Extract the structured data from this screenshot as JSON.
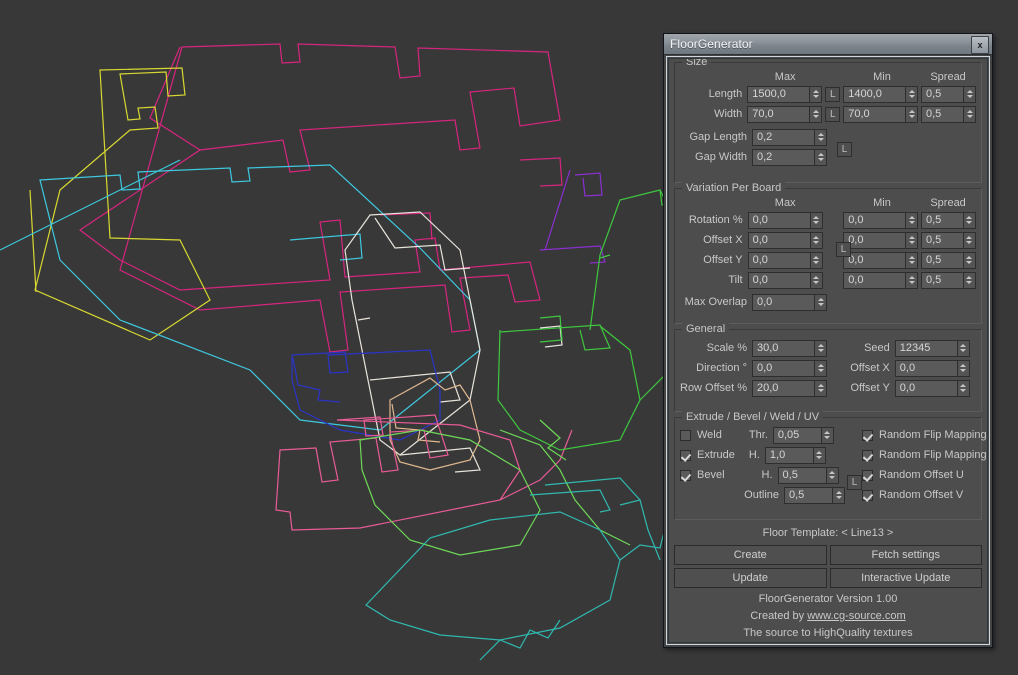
{
  "window": {
    "title": "FloorGenerator",
    "close_label": "x"
  },
  "groups": {
    "size": {
      "title": "Size",
      "columns": {
        "max": "Max",
        "min": "Min",
        "spread": "Spread"
      },
      "rows": [
        {
          "label": "Length",
          "max": "1500,0",
          "link": "L",
          "min": "1400,0",
          "spread": "0,5"
        },
        {
          "label": "Width",
          "max": "70,0",
          "link": "L",
          "min": "70,0",
          "spread": "0,5"
        },
        {
          "label": "Gap Length",
          "max": "0,2"
        },
        {
          "label": "Gap Width",
          "max": "0,2"
        }
      ],
      "gap_link": "L"
    },
    "variation": {
      "title": "Variation Per Board",
      "columns": {
        "max": "Max",
        "min": "Min",
        "spread": "Spread"
      },
      "rows": [
        {
          "label": "Rotation %",
          "max": "0,0",
          "min": "0,0",
          "spread": "0,5"
        },
        {
          "label": "Offset X",
          "max": "0,0",
          "min": "0,0",
          "spread": "0,5"
        },
        {
          "label": "Offset Y",
          "max": "0,0",
          "min": "0,0",
          "spread": "0,5"
        },
        {
          "label": "Tilt",
          "max": "0,0",
          "min": "0,0",
          "spread": "0,5"
        },
        {
          "label": "Max Overlap",
          "max": "0,0"
        }
      ],
      "offset_link": "L"
    },
    "general": {
      "title": "General",
      "left": [
        {
          "label": "Scale %",
          "value": "30,0"
        },
        {
          "label": "Direction °",
          "value": "0,0"
        },
        {
          "label": "Row Offset %",
          "value": "20,0"
        }
      ],
      "right": [
        {
          "label": "Seed",
          "value": "12345"
        },
        {
          "label": "Offset X",
          "value": "0,0"
        },
        {
          "label": "Offset Y",
          "value": "0,0"
        }
      ]
    },
    "extrude": {
      "title": "Extrude / Bevel / Weld / UV",
      "left": [
        {
          "checkbox": true,
          "checked": false,
          "label": "Weld",
          "sublabel": "Thr.",
          "value": "0,05"
        },
        {
          "checkbox": true,
          "checked": true,
          "label": "Extrude",
          "sublabel": "H.",
          "value": "1,0"
        },
        {
          "checkbox": true,
          "checked": true,
          "label": "Bevel",
          "sublabel": "H.",
          "value": "0,5"
        },
        {
          "checkbox": false,
          "checked": false,
          "label": "",
          "sublabel": "Outline",
          "value": "0,5"
        }
      ],
      "right": [
        {
          "checked": true,
          "label": "Random Flip Mapping U"
        },
        {
          "checked": true,
          "label": "Random Flip Mapping V"
        },
        {
          "checked": true,
          "label": "Random Offset U"
        },
        {
          "checked": true,
          "label": "Random Offset V"
        }
      ],
      "bevel_link": "L"
    }
  },
  "footer": {
    "template_text": "Floor Template: < Line13 >",
    "buttons": {
      "create": "Create",
      "fetch": "Fetch settings",
      "update": "Update",
      "interactive": "Interactive Update"
    },
    "version": "FloorGenerator Version 1.00",
    "created_prefix": "Created by ",
    "created_link": "www.cg-source.com",
    "tagline": "The source to HighQuality textures"
  },
  "viewport": {
    "background": "#383838",
    "spline_colors": {
      "magenta": "#d6257e",
      "pink": "#e85b96",
      "yellow": "#d8d832",
      "cyan": "#3ec8e0",
      "teal": "#2fb9b0",
      "white": "#e8e4dc",
      "blue": "#2a35c8",
      "purple": "#8a2fd0",
      "green": "#3fc83f",
      "lightgreen": "#6ed858",
      "tan": "#e0b890"
    }
  }
}
